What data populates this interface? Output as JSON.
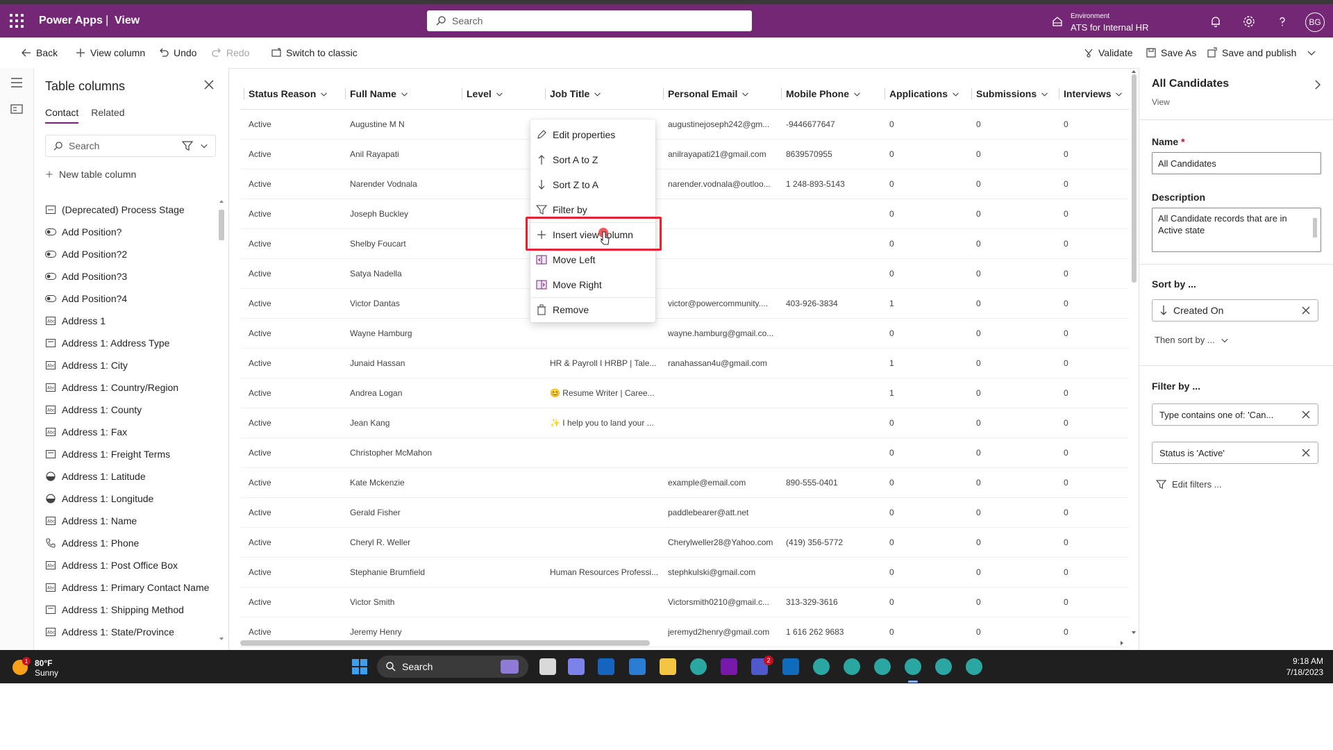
{
  "header": {
    "app_name": "Power Apps",
    "separator": "|",
    "page_name": "View",
    "search_placeholder": "Search",
    "env_label": "Environment",
    "env_name": "ATS for Internal HR",
    "avatar_initials": "BG"
  },
  "commandbar": {
    "back": "Back",
    "view_column": "View column",
    "undo": "Undo",
    "redo": "Redo",
    "switch_classic": "Switch to classic",
    "validate": "Validate",
    "save_as": "Save As",
    "save_publish": "Save and publish"
  },
  "left_panel": {
    "title": "Table columns",
    "tabs": [
      "Contact",
      "Related"
    ],
    "search_placeholder": "Search",
    "new_column": "New table column",
    "items": [
      {
        "label": "(Deprecated) Process Stage",
        "icon": "lookup-icon"
      },
      {
        "label": "Add Position?",
        "icon": "toggle-icon"
      },
      {
        "label": "Add Position?2",
        "icon": "toggle-icon"
      },
      {
        "label": "Add Position?3",
        "icon": "toggle-icon"
      },
      {
        "label": "Add Position?4",
        "icon": "toggle-icon"
      },
      {
        "label": "Address 1",
        "icon": "text-field-icon"
      },
      {
        "label": "Address 1: Address Type",
        "icon": "choice-icon"
      },
      {
        "label": "Address 1: City",
        "icon": "text-field-icon"
      },
      {
        "label": "Address 1: Country/Region",
        "icon": "text-field-icon"
      },
      {
        "label": "Address 1: County",
        "icon": "text-field-icon"
      },
      {
        "label": "Address 1: Fax",
        "icon": "text-field-icon"
      },
      {
        "label": "Address 1: Freight Terms",
        "icon": "choice-icon"
      },
      {
        "label": "Address 1: Latitude",
        "icon": "decimal-icon"
      },
      {
        "label": "Address 1: Longitude",
        "icon": "decimal-icon"
      },
      {
        "label": "Address 1: Name",
        "icon": "text-field-icon"
      },
      {
        "label": "Address 1: Phone",
        "icon": "phone-icon"
      },
      {
        "label": "Address 1: Post Office Box",
        "icon": "text-field-icon"
      },
      {
        "label": "Address 1: Primary Contact Name",
        "icon": "text-field-icon"
      },
      {
        "label": "Address 1: Shipping Method",
        "icon": "choice-icon"
      },
      {
        "label": "Address 1: State/Province",
        "icon": "text-field-icon"
      }
    ]
  },
  "grid": {
    "columns": [
      "Status Reason",
      "Full Name",
      "Level",
      "Job Title",
      "Personal Email",
      "Mobile Phone",
      "Applications",
      "Submissions",
      "Interviews"
    ],
    "rows": [
      [
        "Active",
        "Augustine M N",
        "",
        "",
        "augustinejoseph242@gm...",
        "-9446677647",
        "0",
        "0",
        "0"
      ],
      [
        "Active",
        "Anil Rayapati",
        "",
        "",
        "anilrayapati21@gmail.com",
        "8639570955",
        "0",
        "0",
        "0"
      ],
      [
        "Active",
        "Narender Vodnala",
        "",
        "",
        "narender.vodnala@outloo...",
        "1 248-893-5143",
        "0",
        "0",
        "0"
      ],
      [
        "Active",
        "Joseph Buckley",
        "",
        "",
        "",
        "",
        "0",
        "0",
        "0"
      ],
      [
        "Active",
        "Shelby Foucart",
        "",
        "",
        "",
        "",
        "0",
        "0",
        "0"
      ],
      [
        "Active",
        "Satya Nadella",
        "",
        "",
        "",
        "",
        "0",
        "0",
        "0"
      ],
      [
        "Active",
        "Victor Dantas",
        "",
        "",
        "victor@powercommunity....",
        "403-926-3834",
        "1",
        "0",
        "0"
      ],
      [
        "Active",
        "Wayne Hamburg",
        "",
        "",
        "wayne.hamburg@gmail.co...",
        "",
        "0",
        "0",
        "0"
      ],
      [
        "Active",
        "Junaid Hassan",
        "",
        "HR & Payroll I HRBP | Tale...",
        "ranahassan4u@gmail.com",
        "",
        "1",
        "0",
        "0"
      ],
      [
        "Active",
        "Andrea Logan",
        "",
        "😊 Resume Writer | Caree...",
        "",
        "",
        "1",
        "0",
        "0"
      ],
      [
        "Active",
        "Jean Kang",
        "",
        "✨ I help you to land your ...",
        "",
        "",
        "0",
        "0",
        "0"
      ],
      [
        "Active",
        "Christopher McMahon",
        "",
        "",
        "",
        "",
        "0",
        "0",
        "0"
      ],
      [
        "Active",
        "Kate Mckenzie",
        "",
        "",
        "example@email.com",
        "890-555-0401",
        "0",
        "0",
        "0"
      ],
      [
        "Active",
        "Gerald Fisher",
        "",
        "",
        "paddlebearer@att.net",
        "",
        "0",
        "0",
        "0"
      ],
      [
        "Active",
        "Cheryl R. Weller",
        "",
        "",
        "Cherylweller28@Yahoo.com",
        "(419) 356-5772",
        "0",
        "0",
        "0"
      ],
      [
        "Active",
        "Stephanie Brumfield",
        "",
        "Human Resources Professi...",
        "stephkulski@gmail.com",
        "",
        "0",
        "0",
        "0"
      ],
      [
        "Active",
        "Victor Smith",
        "",
        "",
        "Victorsmith0210@gmail.c...",
        "313-329-3616",
        "0",
        "0",
        "0"
      ],
      [
        "Active",
        "Jeremy Henry",
        "",
        "",
        "jeremyd2henry@gmail.com",
        "1 616 262 9683",
        "0",
        "0",
        "0"
      ]
    ]
  },
  "context_menu": {
    "items": [
      "Edit properties",
      "Sort A to Z",
      "Sort Z to A",
      "Filter by",
      "Insert view column",
      "Move Left",
      "Move Right",
      "Remove"
    ],
    "highlighted": "Insert view column"
  },
  "right_panel": {
    "title": "All Candidates",
    "subtitle": "View",
    "name_label": "Name",
    "required_mark": "*",
    "name_value": "All Candidates",
    "description_label": "Description",
    "description_value": "All Candidate records that are in Active state",
    "sort_label": "Sort by ...",
    "sort_value": "Created On",
    "then_sort": "Then sort by ...",
    "filter_label": "Filter by ...",
    "filter_1": "Type contains one of: 'Can...",
    "filter_2": "Status is 'Active'",
    "edit_filters": "Edit filters ..."
  },
  "taskbar": {
    "weather_temp": "80°F",
    "weather_desc": "Sunny",
    "weather_badge": "1",
    "search": "Search",
    "teams_badge": "2",
    "time": "9:18 AM",
    "date": "7/18/2023"
  },
  "colors": {
    "header_bg": "#742774",
    "highlight_box": "#e8222e",
    "taskbar_bg": "#1f1f1f"
  }
}
